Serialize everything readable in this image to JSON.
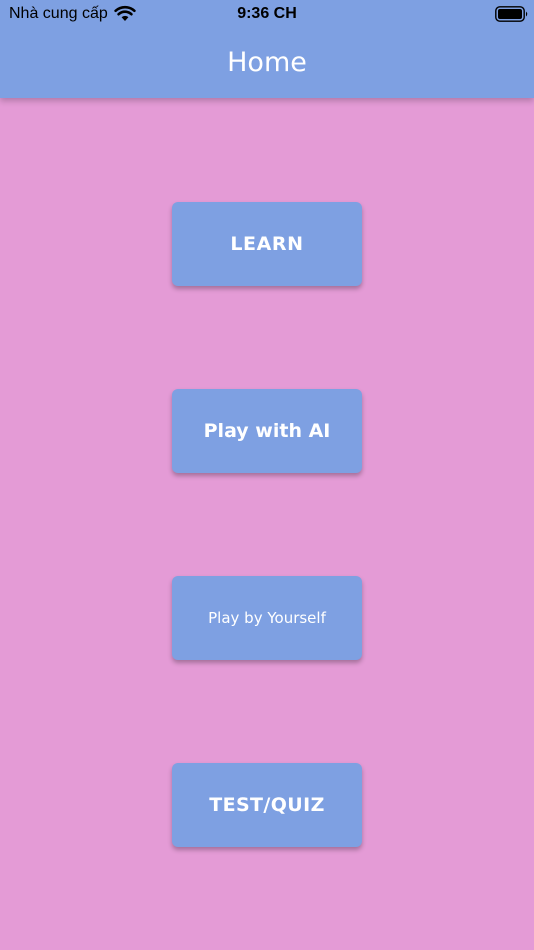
{
  "status_bar": {
    "carrier": "Nhà cung cấp",
    "time": "9:36 CH",
    "wifi_icon": "wifi-icon",
    "battery_icon": "battery-icon"
  },
  "app_bar": {
    "title": "Home",
    "color": "#7EA0E2"
  },
  "background_color": "#E49BD6",
  "buttons": {
    "learn": "LEARN",
    "play_with_ai": "Play with AI",
    "play_by_yourself": "Play by Yourself",
    "test_quiz": "TEST/QUIZ"
  }
}
